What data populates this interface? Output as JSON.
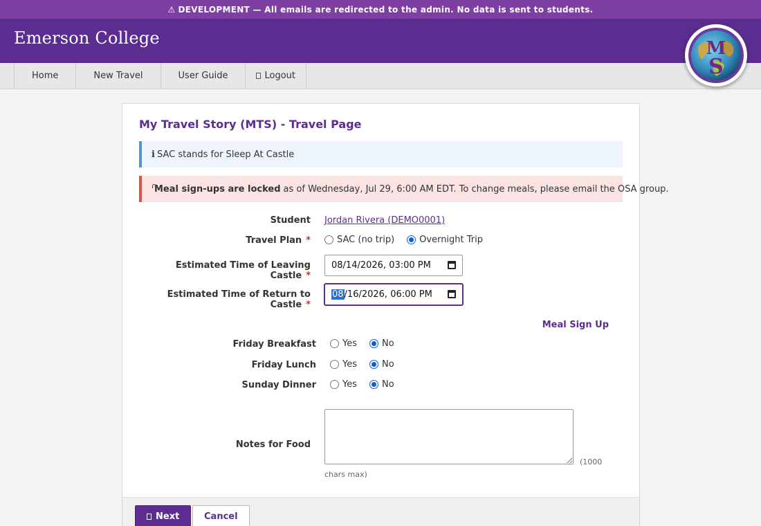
{
  "banner": {
    "icon": "⚠",
    "text": "DEVELOPMENT — All emails are redirected to the admin. No data is sent to students."
  },
  "header": {
    "brand": "Emerson College",
    "logo_icon": "mts-globe-logo"
  },
  "nav": {
    "home": "Home",
    "new_travel": "New Travel",
    "user_guide": "User Guide",
    "logout": "Logout"
  },
  "page": {
    "title": "My Travel Story (MTS) - Travel Page"
  },
  "info_alert": {
    "icon": "i",
    "text": "SAC stands for Sleep At Castle"
  },
  "locked_alert": {
    "bold": "Meal sign-ups are locked",
    "text": "as of Wednesday, Jul 29, 6:00 AM EDT. To change meals, please email the OSA group."
  },
  "form": {
    "student_label": "Student",
    "student_value": "Jordan Rivera (DEMO0001)",
    "travel_plan_label": "Travel Plan",
    "required_mark": "*",
    "travel_plan_options": [
      "SAC (no trip)",
      "Overnight Trip"
    ],
    "travel_plan_selected": "Overnight Trip",
    "leaving_label": "Estimated Time of Leaving Castle",
    "leaving_value": "08/14/2026, 03:00 PM",
    "return_label": "Estimated Time of Return to Castle",
    "return_value_selected": "08",
    "return_value_rest": "/16/2026, 06:00 PM"
  },
  "meals": {
    "heading": "Meal Sign Up",
    "yes": "Yes",
    "no": "No",
    "items": [
      {
        "label": "Friday Breakfast",
        "selected": "No"
      },
      {
        "label": "Friday Lunch",
        "selected": "No"
      },
      {
        "label": "Sunday Dinner",
        "selected": "No"
      }
    ]
  },
  "notes": {
    "label": "Notes for Food",
    "value": "",
    "hint_a": "(1000",
    "hint_b": "chars max)"
  },
  "actions": {
    "next": "Next",
    "cancel": "Cancel"
  },
  "colors": {
    "brand": "#5c2d91",
    "banner": "#7e3fa3",
    "danger_bg": "#fbe3e3",
    "info_bg": "#eef4fb"
  }
}
